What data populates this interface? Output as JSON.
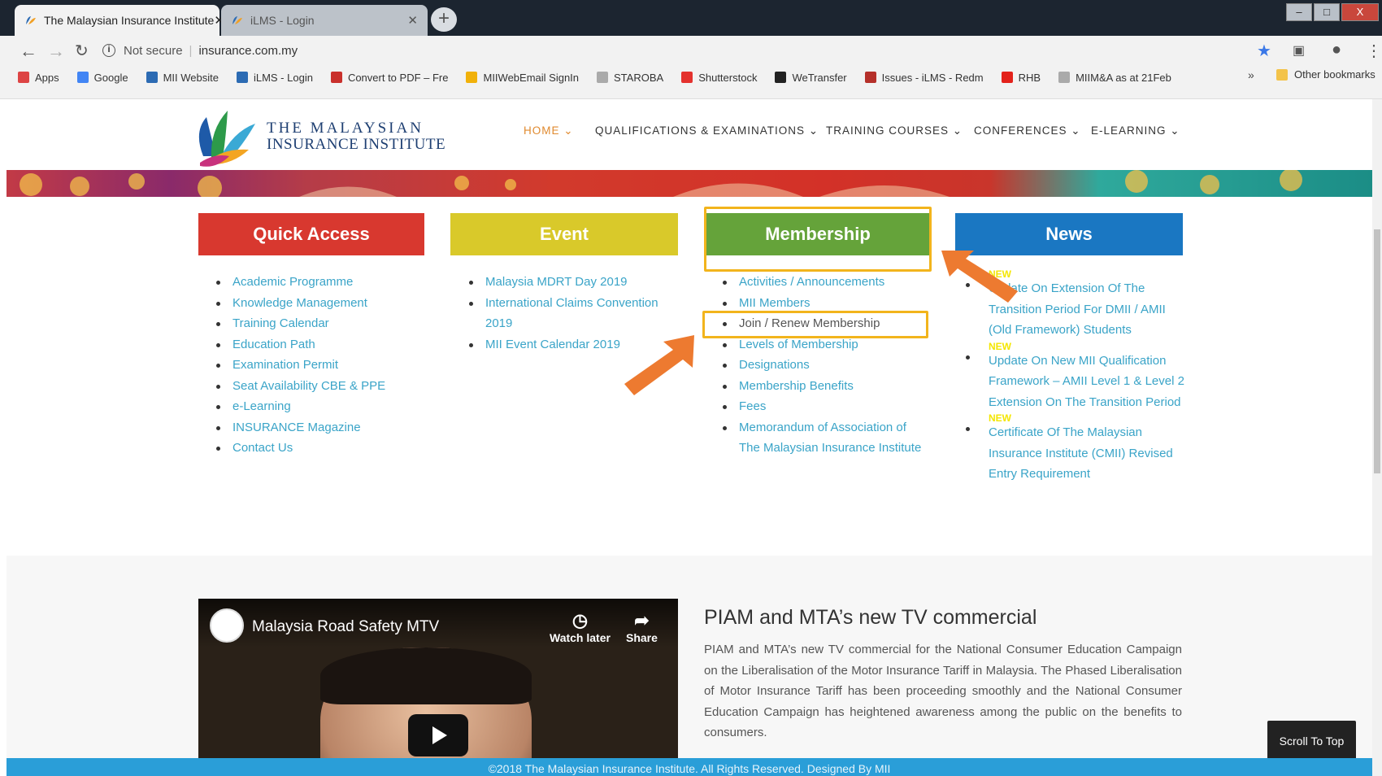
{
  "browser": {
    "tabs": [
      {
        "title": "The Malaysian Insurance Institute"
      },
      {
        "title": "iLMS - Login"
      }
    ],
    "new_tab_label": "+",
    "window_controls": {
      "minimize": "–",
      "maximize": "□",
      "close": "X"
    },
    "omnibox": {
      "security": "Not secure",
      "url": "insurance.com.my"
    },
    "bookmarks": [
      {
        "label": "Apps",
        "icon": "apps-grid-icon",
        "color": "#d44"
      },
      {
        "label": "Google",
        "icon": "google-g-icon",
        "color": "#4285f4"
      },
      {
        "label": "MII Website",
        "icon": "mii-leaf-icon",
        "color": "#2c6bb3"
      },
      {
        "label": "iLMS - Login",
        "icon": "mii-leaf-icon",
        "color": "#2c6bb3"
      },
      {
        "label": "Convert to PDF – Fre",
        "icon": "pdf-icon",
        "color": "#c9302c"
      },
      {
        "label": "MIIWebEmail SignIn",
        "icon": "windows-icon",
        "color": "#f1b10a"
      },
      {
        "label": "STAROBA",
        "icon": "page-icon",
        "color": "#aaa"
      },
      {
        "label": "Shutterstock",
        "icon": "shutterstock-icon",
        "color": "#e4322e"
      },
      {
        "label": "WeTransfer",
        "icon": "wetransfer-icon",
        "color": "#222"
      },
      {
        "label": "Issues - iLMS - Redm",
        "icon": "redmine-icon",
        "color": "#b5302a"
      },
      {
        "label": "RHB",
        "icon": "rhb-diamond-icon",
        "color": "#e3221b"
      },
      {
        "label": "MIIM&A as at 21Feb",
        "icon": "page-icon",
        "color": "#aaa"
      }
    ],
    "bookmarks_more": "»",
    "other_bookmarks": "Other bookmarks"
  },
  "site": {
    "logo_line1": "THE MALAYSIAN",
    "logo_line2": "INSURANCE INSTITUTE",
    "nav": [
      {
        "label": "HOME ⌄"
      },
      {
        "label": "QUALIFICATIONS & EXAMINATIONS ⌄"
      },
      {
        "label": "TRAINING COURSES ⌄"
      },
      {
        "label": "CONFERENCES ⌄"
      },
      {
        "label": "E-LEARNING ⌄"
      }
    ]
  },
  "panels": {
    "quick_access": {
      "title": "Quick Access",
      "color": "#d8382f",
      "links": [
        "Academic Programme",
        "Knowledge Management",
        "Training Calendar",
        "Education Path",
        "Examination Permit",
        "Seat Availability CBE & PPE",
        "e-Learning",
        "INSURANCE Magazine",
        "Contact Us"
      ]
    },
    "event": {
      "title": "Event",
      "color": "#d9c92a",
      "links": [
        "Malaysia MDRT Day 2019",
        "International Claims Convention 2019",
        "MII Event Calendar 2019"
      ]
    },
    "membership": {
      "title": "Membership",
      "color": "#65a33a",
      "links": [
        "Activities / Announcements",
        "MII Members",
        "Join / Renew Membership",
        "Levels of Membership",
        "Designations",
        "Membership Benefits",
        "Fees",
        "Memorandum of Association of The Malaysian Insurance Institute"
      ]
    },
    "news": {
      "title": "News",
      "color": "#1a77c2",
      "items": [
        {
          "badge": "NEW",
          "text": "Update On Extension Of The Transition Period For DMII / AMII (Old Framework) Students"
        },
        {
          "badge": "NEW",
          "text": "Update On New MII Qualification Framework – AMII Level 1 & Level 2 Extension On The Transition Period"
        },
        {
          "badge": "NEW",
          "text": "Certificate Of The Malaysian Insurance Institute (CMII) Revised Entry Requirement"
        }
      ]
    }
  },
  "annotations": {
    "highlight_color": "#f2b41c",
    "arrow_color": "#ed7a30"
  },
  "video": {
    "title": "Malaysia Road Safety MTV",
    "watch_later": "Watch later",
    "share": "Share"
  },
  "article": {
    "title": "PIAM and MTA’s new TV commercial",
    "body": "PIAM and MTA’s new TV commercial for the National Consumer Education Campaign on the Liberalisation of the Motor Insurance Tariff in Malaysia. The Phased Liberalisation of Motor Insurance Tariff has been proceeding smoothly and the National Consumer Education Campaign has heightened awareness among the public on the benefits to consumers."
  },
  "scroll_to_top": "Scroll To Top",
  "footer": "©2018 The Malaysian Insurance Institute. All Rights Reserved. Designed By MII"
}
